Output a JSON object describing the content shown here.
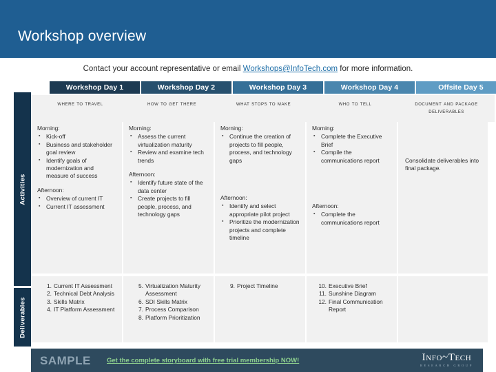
{
  "slide": {
    "title": "Workshop overview",
    "contact": {
      "before": "Contact your account representative or email ",
      "email": "Workshops@InfoTech.com",
      "after": " for more information."
    }
  },
  "colors": {
    "banner": "#1f5e92",
    "rail": "#14334c",
    "header_day1": "#1d3a52",
    "header_day2": "#27506e",
    "header_day3": "#356f97",
    "header_day4": "#4a86ae",
    "header_day5": "#5f9cc4",
    "cell": "#f1f1f1",
    "footer": "#2e4a5e",
    "link": "#1f6fa8",
    "promo": "#8fd18f"
  },
  "rails": {
    "activities": "Activities",
    "deliverables": "Deliverables"
  },
  "columns": [
    {
      "header": "Workshop Day 1",
      "subtitle": "Where to Travel",
      "activities": {
        "morning_label": "Morning:",
        "morning": [
          "Kick-off",
          "Business and stakeholder goal review",
          "Identify goals of modernization and measure of success"
        ],
        "afternoon_label": "Afternoon:",
        "afternoon": [
          "Overview of current IT",
          "Current IT assessment"
        ]
      },
      "deliverables": [
        {
          "num": "1.",
          "text": "Current IT Assessment"
        },
        {
          "num": "2.",
          "text": "Technical Debt Analysis"
        },
        {
          "num": "3.",
          "text": "Skills Matrix"
        },
        {
          "num": "4.",
          "text": "IT Platform Assessment"
        }
      ]
    },
    {
      "header": "Workshop Day 2",
      "subtitle": "How to Get There",
      "activities": {
        "morning_label": "Morning:",
        "morning": [
          "Assess the current virtualization maturity",
          "Review and examine tech trends"
        ],
        "afternoon_label": "Afternoon:",
        "afternoon": [
          "Identify future state of the data center",
          "Create projects to fill people, process, and technology gaps"
        ]
      },
      "deliverables": [
        {
          "num": "5.",
          "text": "Virtualization Maturity Assessment"
        },
        {
          "num": "6.",
          "text": "SDI Skills Matrix"
        },
        {
          "num": "7.",
          "text": "Process Comparison"
        },
        {
          "num": "8.",
          "text": "Platform Prioritization"
        }
      ]
    },
    {
      "header": "Workshop Day 3",
      "subtitle": "What Stops to Make",
      "activities": {
        "morning_label": "Morning:",
        "morning": [
          "Continue the creation of projects to fill people, process, and technology gaps"
        ],
        "afternoon_label": "Afternoon:",
        "afternoon": [
          "Identify and select appropriate pilot project",
          "Prioritize the modernization projects and complete timeline"
        ]
      },
      "deliverables": [
        {
          "num": "9.",
          "text": "Project Timeline"
        }
      ]
    },
    {
      "header": "Workshop Day 4",
      "subtitle": "Who to Tell",
      "activities": {
        "morning_label": "Morning:",
        "morning": [
          "Complete the Executive Brief",
          "Compile the communications report"
        ],
        "afternoon_label": "Afternoon:",
        "afternoon": [
          "Complete the communications report"
        ]
      },
      "deliverables": [
        {
          "num": "10.",
          "text": "Executive Brief"
        },
        {
          "num": "11.",
          "text": "Sunshine Diagram"
        },
        {
          "num": "12.",
          "text": "Final Communication Report"
        }
      ]
    },
    {
      "header": "Offsite Day 5",
      "subtitle": "Document and package deliverables",
      "activities": {
        "plain": "Consolidate deliverables into final package."
      },
      "deliverables": []
    }
  ],
  "footer": {
    "sample": "SAMPLE",
    "promo": "Get the complete storyboard with free trial membership NOW!",
    "logo_main": "Info~Tech",
    "logo_sub": "RESEARCH GROUP"
  }
}
